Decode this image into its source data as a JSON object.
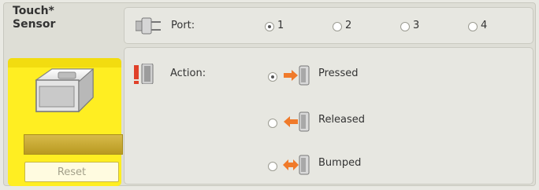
{
  "block": {
    "title": "Touch*\nSensor",
    "reset_label": "Reset"
  },
  "port": {
    "label": "Port:",
    "options": [
      "1",
      "2",
      "3",
      "4"
    ],
    "selected": "1"
  },
  "action": {
    "label": "Action:",
    "options": [
      "Pressed",
      "Released",
      "Bumped"
    ],
    "selected": "Pressed"
  },
  "colors": {
    "block_yellow": "#ffee22",
    "arrow_orange": "#f07a2a"
  }
}
